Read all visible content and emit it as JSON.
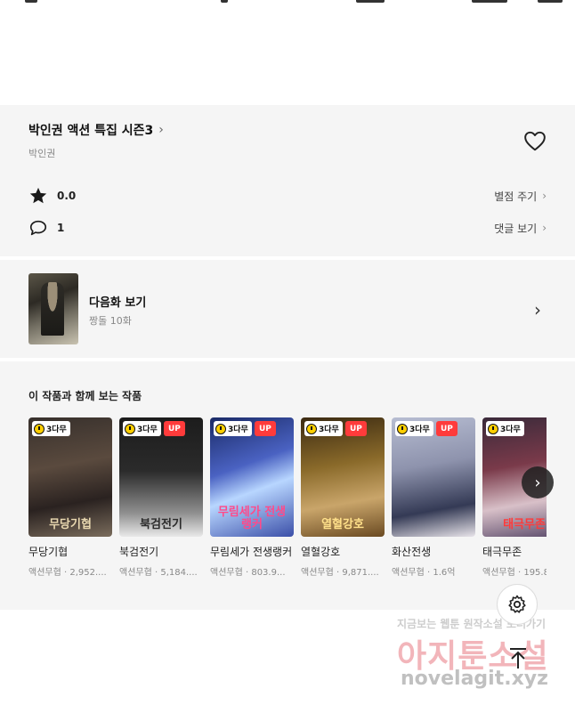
{
  "series": {
    "title": "박인권 액션 특집 시즌3",
    "author": "박인권",
    "rating": "0.0",
    "rate_link": "별점 주기",
    "comment_count": "1",
    "comment_link": "댓글 보기"
  },
  "next_episode": {
    "label": "다음화 보기",
    "subtitle": "짱돌 10화"
  },
  "recommendations": {
    "heading": "이 작품과 함께 보는 작품",
    "badge_free": "3다무",
    "badge_up": "UP",
    "items": [
      {
        "title": "무당기협",
        "meta": "액션무협 · 2,952....",
        "cover_text": "무당기협",
        "up": false
      },
      {
        "title": "북검전기",
        "meta": "액션무협 · 5,184....",
        "cover_text": "북검전기",
        "up": true
      },
      {
        "title": "무림세가 전생랭커",
        "meta": "액션무협 · 803.9...",
        "cover_text": "무림세가 전생랭커",
        "up": true
      },
      {
        "title": "열혈강호",
        "meta": "액션무협 · 9,871....",
        "cover_text": "열혈강호",
        "up": true
      },
      {
        "title": "화산전생",
        "meta": "액션무협 · 1.6억",
        "cover_text": "",
        "up": true
      },
      {
        "title": "태극무존",
        "meta": "액션무협 · 195.8",
        "cover_text": "태극무존",
        "up": false
      }
    ]
  },
  "watermark": {
    "top": "지금보는 웹툰 원작소설 보러가기",
    "big": "아지툰소설",
    "url": "novelagit.xyz"
  },
  "icons": {
    "heart": "heart-icon",
    "star": "star-icon",
    "comment": "comment-icon",
    "chevron": "chevron-right-icon",
    "settings": "gear-icon",
    "scroll_top": "arrow-up-icon"
  },
  "colors": {
    "panel_bg": "#f5f5f5",
    "up_badge": "#ff3b3b",
    "free_badge_clock": "#ffcf00"
  }
}
